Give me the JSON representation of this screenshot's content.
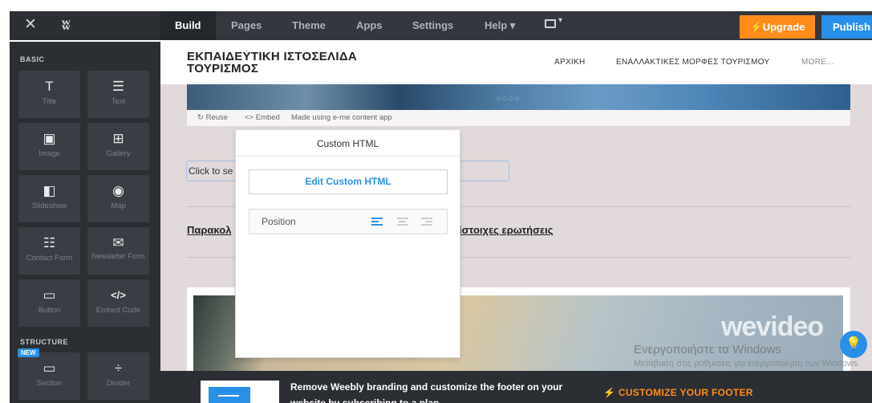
{
  "topbar": {
    "close_glyph": "✕",
    "logo_glyph": "ʬ",
    "tabs": [
      "Build",
      "Pages",
      "Theme",
      "Apps",
      "Settings",
      "Help ▾"
    ],
    "active_tab": "Build",
    "device_caret": "▾",
    "upgrade_label": "⚡Upgrade",
    "publish_label": "Publish"
  },
  "sidebar": {
    "basic_label": "BASIC",
    "structure_label": "STRUCTURE",
    "new_badge": "NEW",
    "basic_items": [
      {
        "icon": "T",
        "label": "Title"
      },
      {
        "icon": "☰",
        "label": "Text"
      },
      {
        "icon": "▣",
        "label": "Image"
      },
      {
        "icon": "⊞",
        "label": "Gallery"
      },
      {
        "icon": "◧",
        "label": "Slideshow"
      },
      {
        "icon": "◉",
        "label": "Map"
      },
      {
        "icon": "☷",
        "label": "Contact Form"
      },
      {
        "icon": "✉",
        "label": "Newsletter Form"
      },
      {
        "icon": "▭",
        "label": "Button"
      },
      {
        "icon": "</>",
        "label": "Embed Code"
      }
    ],
    "structure_items": [
      {
        "icon": "▭",
        "label": "Section"
      },
      {
        "icon": "÷",
        "label": "Divider"
      }
    ]
  },
  "site": {
    "title": "ΕΚΠΑΙΔΕΥΤΙΚΗ ΙΣΤΟΣΕΛΙΔΑ ΤΟΥΡΙΣΜΟΣ",
    "nav": [
      "ΑΡΧΙΚΗ",
      "ΕΝΑΛΛΑΚΤΙΚΕΣ ΜΟΡΦΕΣ ΤΟΥΡΙΣΜΟΥ",
      "MORE..."
    ],
    "slide_dots": "○○○○",
    "reuse_label": "↻ Reuse",
    "embed_label": "<> Embed",
    "made_using": "Made using e-me content app",
    "click_to_set": "Click to se",
    "link_left": "Παρακολ",
    "link_right": "ίστοιχες ερωτήσεις",
    "wevideo_watermark": "wevideo",
    "activate_title": "Ενεργοποιήστε τα Windows",
    "activate_sub": "Μετάβαση στις ρυθμίσεις για ενεργοποίηση των Windows.",
    "help_glyph": "💡"
  },
  "popup": {
    "title": "Custom HTML",
    "edit_button": "Edit Custom HTML",
    "position_label": "Position",
    "selected_alignment": "left"
  },
  "footer": {
    "message": "Remove Weebly branding and customize the footer on your website by subscribing to a plan",
    "cta": "⚡  CUSTOMIZE YOUR FOOTER"
  },
  "colors": {
    "accent": "#2990ea",
    "upgrade": "#ff8c1a",
    "sidebar": "#2b2e33",
    "canvas": "#e2d9da"
  }
}
